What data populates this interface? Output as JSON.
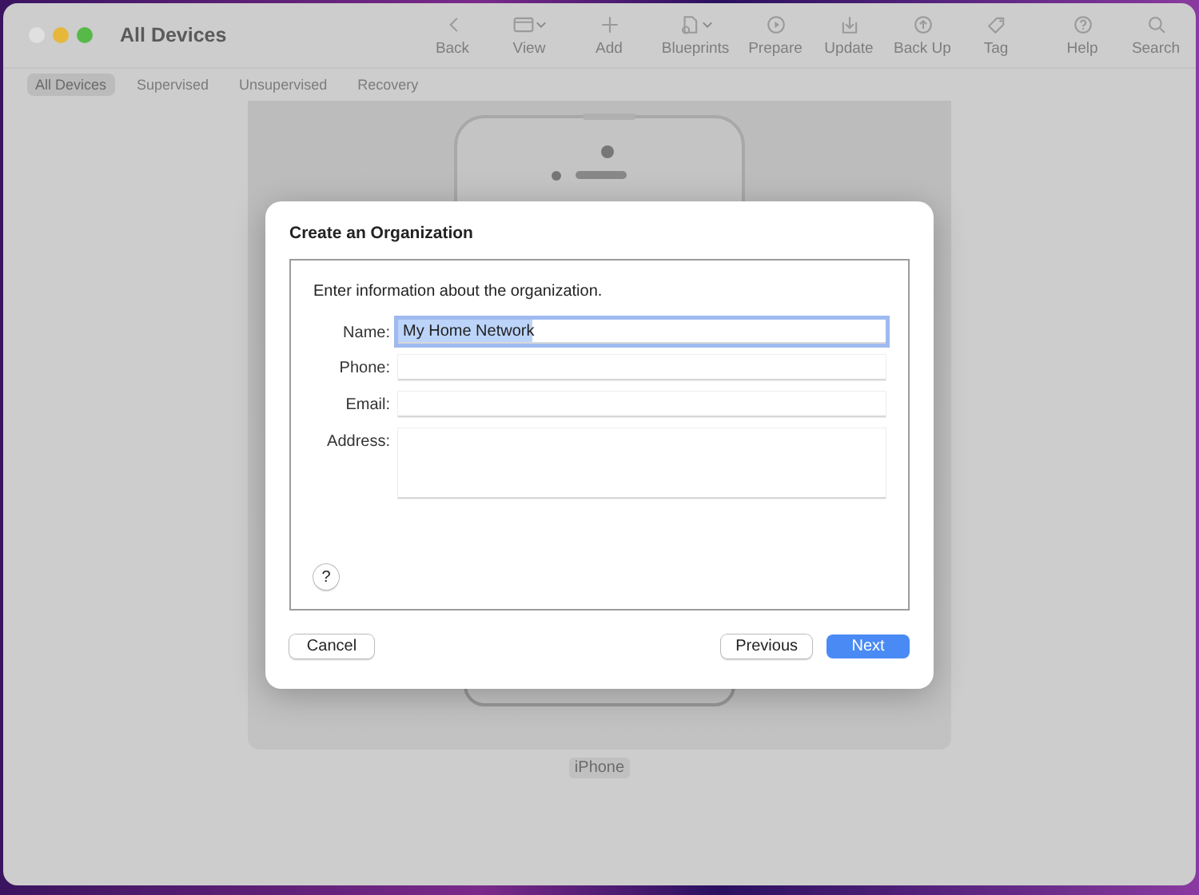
{
  "window": {
    "title": "All Devices"
  },
  "toolbar": [
    {
      "label": "Back",
      "menu": false
    },
    {
      "label": "View",
      "menu": true
    },
    {
      "label": "Add",
      "menu": false
    },
    {
      "label": "Blueprints",
      "menu": true
    },
    {
      "label": "Prepare",
      "menu": false
    },
    {
      "label": "Update",
      "menu": false
    },
    {
      "label": "Back Up",
      "menu": false
    },
    {
      "label": "Tag",
      "menu": false
    },
    {
      "label": "Help",
      "menu": false
    },
    {
      "label": "Search",
      "menu": false
    }
  ],
  "tabs": [
    {
      "label": "All Devices",
      "selected": true
    },
    {
      "label": "Supervised",
      "selected": false
    },
    {
      "label": "Unsupervised",
      "selected": false
    },
    {
      "label": "Recovery",
      "selected": false
    }
  ],
  "device": {
    "label": "iPhone"
  },
  "dialog": {
    "title": "Create an Organization",
    "description": "Enter information about the organization.",
    "fields": [
      {
        "label": "Name:",
        "kind": "text",
        "value": "My Home Network",
        "focused": true
      },
      {
        "label": "Phone:",
        "kind": "text",
        "focused": false
      },
      {
        "label": "Email:",
        "kind": "text",
        "focused": false
      },
      {
        "label": "Address:",
        "kind": "textarea",
        "focused": false
      }
    ],
    "help": "?",
    "buttons_left": [
      {
        "label": "Cancel",
        "default": false
      }
    ],
    "buttons_right": [
      {
        "label": "Previous",
        "default": false
      },
      {
        "label": "Next",
        "default": true
      }
    ]
  }
}
